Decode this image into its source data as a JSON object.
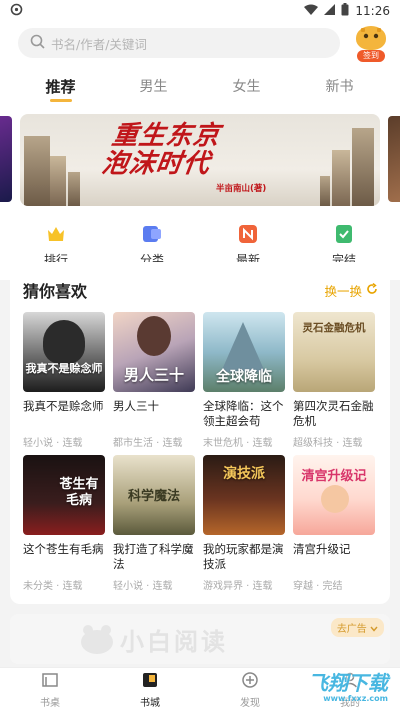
{
  "status": {
    "time": "11:26"
  },
  "search": {
    "placeholder": "书名/作者/关键词"
  },
  "checkin": {
    "label": "签到"
  },
  "tabs": [
    {
      "label": "推荐"
    },
    {
      "label": "男生"
    },
    {
      "label": "女生"
    },
    {
      "label": "新书"
    }
  ],
  "banner": {
    "title_line1": "重生东京",
    "title_line2": "泡沫时代",
    "author": "半亩南山(著)"
  },
  "quick": [
    {
      "label": "排行",
      "icon": "trophy-icon",
      "color": "#f7c229"
    },
    {
      "label": "分类",
      "icon": "category-icon",
      "color": "#5b7cf0"
    },
    {
      "label": "最新",
      "icon": "new-icon",
      "color": "#f0643a"
    },
    {
      "label": "完结",
      "icon": "complete-icon",
      "color": "#3fba6f"
    }
  ],
  "guess": {
    "title": "猜你喜欢",
    "refresh": "换一换",
    "books": [
      {
        "title": "我真不是赊念师",
        "tags": "轻小说 · 连载",
        "cover_text": "我真不是赊念师"
      },
      {
        "title": "男人三十",
        "tags": "都市生活 · 连载",
        "cover_text": "男人三十"
      },
      {
        "title": "全球降临：这个领主超会苟",
        "tags": "末世危机 · 连载",
        "cover_text": "全球降临"
      },
      {
        "title": "第四次灵石金融危机",
        "tags": "超级科技 · 连载",
        "cover_text": "灵石金融危机"
      },
      {
        "title": "这个苍生有毛病",
        "tags": "未分类 · 连载",
        "cover_text": "苍生有毛病"
      },
      {
        "title": "我打造了科学魔法",
        "tags": "轻小说 · 连载",
        "cover_text": "科学魔法"
      },
      {
        "title": "我的玩家都是演技派",
        "tags": "游戏异界 · 连载",
        "cover_text": "演技派"
      },
      {
        "title": "清宫升级记",
        "tags": "穿越 · 完结",
        "cover_text": "清宫升级记"
      }
    ]
  },
  "ad": {
    "logo": "小白阅读",
    "close": "去广告"
  },
  "bottom_nav": [
    {
      "label": "书桌"
    },
    {
      "label": "书城"
    },
    {
      "label": "发现"
    },
    {
      "label": "我的"
    }
  ],
  "watermark": {
    "text": "飞翔下载",
    "url": "www.fxxz.com"
  }
}
